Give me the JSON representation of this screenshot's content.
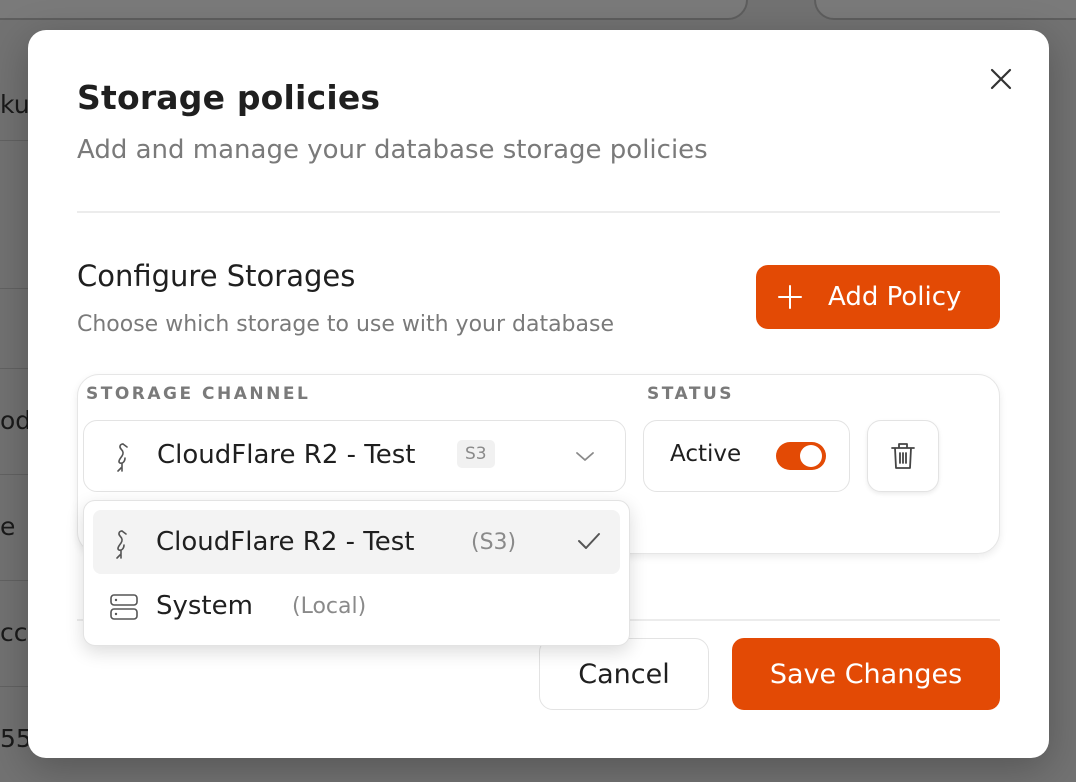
{
  "background": {
    "fragments": [
      "ku",
      "od",
      "e",
      "cc",
      "55"
    ]
  },
  "modal": {
    "title": "Storage policies",
    "subtitle": "Add and manage your database storage policies",
    "section_title": "Configure Storages",
    "section_subtitle": "Choose which storage to use with your database",
    "add_button_label": "Add Policy",
    "columns": {
      "channel": "STORAGE CHANNEL",
      "status": "STATUS"
    },
    "selected_storage": {
      "name": "CloudFlare R2 - Test",
      "badge": "S3"
    },
    "status_label": "Active",
    "status_enabled": true,
    "cancel_label": "Cancel",
    "save_label": "Save Changes"
  },
  "dropdown": {
    "options": [
      {
        "name": "CloudFlare R2 - Test",
        "type": "(S3)",
        "icon": "flamingo-icon",
        "selected": true
      },
      {
        "name": "System",
        "type": "(Local)",
        "icon": "server-icon",
        "selected": false
      }
    ]
  },
  "colors": {
    "accent": "#e34a05",
    "muted_text": "#7a7a7a",
    "border": "#e3e3e3"
  }
}
